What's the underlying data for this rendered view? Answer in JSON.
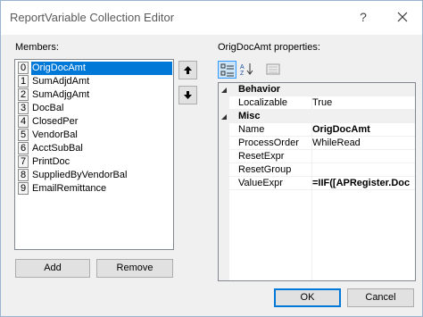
{
  "window": {
    "title": "ReportVariable Collection Editor",
    "help_glyph": "?"
  },
  "members": {
    "label": "Members:",
    "items": [
      {
        "index": "0",
        "name": "OrigDocAmt",
        "selected": true
      },
      {
        "index": "1",
        "name": "SumAdjdAmt"
      },
      {
        "index": "2",
        "name": "SumAdjgAmt"
      },
      {
        "index": "3",
        "name": "DocBal"
      },
      {
        "index": "4",
        "name": "ClosedPer"
      },
      {
        "index": "5",
        "name": "VendorBal"
      },
      {
        "index": "6",
        "name": "AcctSubBal"
      },
      {
        "index": "7",
        "name": "PrintDoc"
      },
      {
        "index": "8",
        "name": "SuppliedByVendorBal"
      },
      {
        "index": "9",
        "name": "EmailRemittance"
      }
    ],
    "add_label": "Add",
    "remove_label": "Remove"
  },
  "properties": {
    "label": "OrigDocAmt properties:",
    "categories": [
      {
        "name": "Behavior",
        "rows": [
          {
            "name": "Localizable",
            "value": "True"
          }
        ]
      },
      {
        "name": "Misc",
        "rows": [
          {
            "name": "Name",
            "value": "OrigDocAmt",
            "bold": true
          },
          {
            "name": "ProcessOrder",
            "value": "WhileRead"
          },
          {
            "name": "ResetExpr",
            "value": ""
          },
          {
            "name": "ResetGroup",
            "value": ""
          },
          {
            "name": "ValueExpr",
            "value": "=IIF([APRegister.Doc",
            "bold": true
          }
        ]
      }
    ]
  },
  "footer": {
    "ok_label": "OK",
    "cancel_label": "Cancel"
  },
  "colors": {
    "selection": "#0078d7",
    "button_face": "#e1e1e1",
    "window_bg": "#f0f0f0"
  }
}
